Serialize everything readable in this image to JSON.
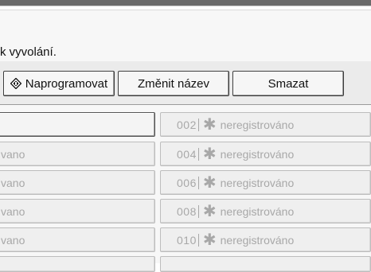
{
  "screen": {
    "message": "k vyvolání."
  },
  "toolbar": {
    "program_label": "Naprogramovat",
    "program_icon": "program-diamond-icon",
    "rename_label": "Změnit název",
    "delete_label": "Smazat"
  },
  "slots": {
    "unregistered": "neregistrováno",
    "unregistered_partial": "vano",
    "star": "✱",
    "left": [
      {
        "num": "",
        "label": ""
      },
      {
        "num": "",
        "label": "vano"
      },
      {
        "num": "",
        "label": "vano"
      },
      {
        "num": "",
        "label": "vano"
      },
      {
        "num": "",
        "label": "vano"
      }
    ],
    "right": [
      {
        "num": "002",
        "label": "neregistrováno"
      },
      {
        "num": "004",
        "label": "neregistrováno"
      },
      {
        "num": "006",
        "label": "neregistrováno"
      },
      {
        "num": "008",
        "label": "neregistrováno"
      },
      {
        "num": "010",
        "label": "neregistrováno"
      }
    ]
  },
  "colors": {
    "topbar": "#6a6a6a",
    "disabled_text": "#a8a8a8",
    "panel": "#f7f7f7"
  }
}
